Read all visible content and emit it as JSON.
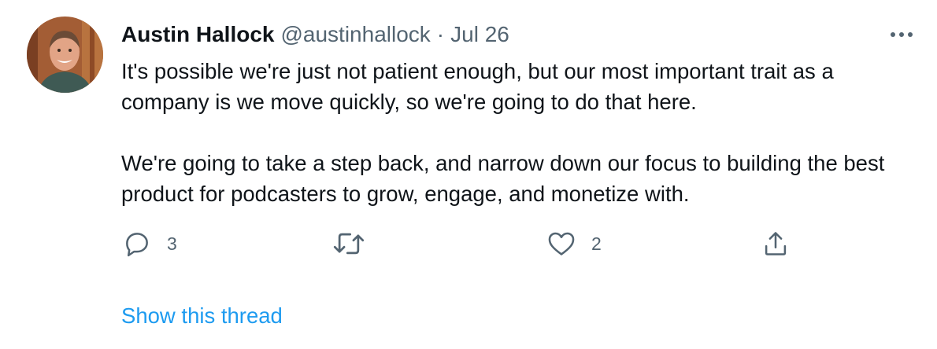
{
  "tweet": {
    "author_name": "Austin Hallock",
    "handle": "@austinhallock",
    "separator": "·",
    "date": "Jul 26",
    "paragraphs": [
      "It's possible we're just not patient enough, but our most important trait as a company is we move quickly, so we're going to do that here.",
      "We're going to take a step back, and narrow down our focus to building the best product for podcasters to grow, engage, and monetize with."
    ]
  },
  "actions": {
    "reply_count": "3",
    "retweet_count": "",
    "like_count": "2"
  },
  "icons": {
    "more": "more-horizontal-icon",
    "reply": "reply-icon",
    "retweet": "retweet-icon",
    "like": "heart-icon",
    "share": "share-icon"
  },
  "show_thread_label": "Show this thread",
  "colors": {
    "link": "#1d9bf0",
    "secondary_text": "#536471",
    "primary_text": "#0f1419"
  }
}
